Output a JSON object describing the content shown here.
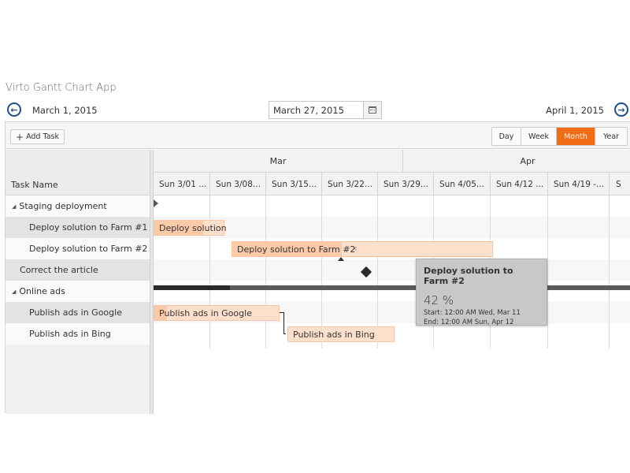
{
  "app": {
    "title": "Virto Gantt Chart App"
  },
  "nav": {
    "start_date": "March 1, 2015",
    "current_date": "March 27, 2015",
    "end_date": "April 1, 2015"
  },
  "toolbar": {
    "add_task_label": "Add Task",
    "views": [
      {
        "label": "Day",
        "active": false
      },
      {
        "label": "Week",
        "active": false
      },
      {
        "label": "Month",
        "active": true
      },
      {
        "label": "Year",
        "active": false
      }
    ]
  },
  "grid": {
    "column_header": "Task Name",
    "rows": [
      {
        "label": "Staging deployment",
        "expandable": true
      },
      {
        "label": "Deploy solution to Farm #1",
        "expandable": false
      },
      {
        "label": "Deploy solution to Farm #2",
        "expandable": false
      },
      {
        "label": "Correct the article",
        "expandable": false
      },
      {
        "label": "Online ads",
        "expandable": true
      },
      {
        "label": "Publish ads in Google",
        "expandable": false
      },
      {
        "label": "Publish ads in Bing",
        "expandable": false
      }
    ]
  },
  "timeline": {
    "months": [
      "Mar",
      "Apr"
    ],
    "weeks": [
      "Sun 3/01 ...",
      "Sun 3/08...",
      "Sun 3/15...",
      "Sun 3/22...",
      "Sun 3/29...",
      "Sun 4/05...",
      "Sun 4/12 ...",
      "Sun 4/19 -...",
      "S"
    ]
  },
  "bars": {
    "farm1": {
      "label": "Deploy solution",
      "progress": 0.7
    },
    "farm2": {
      "label": "Deploy solution to Farm #2",
      "progress": 0.42
    },
    "google": {
      "label": "Publish ads in Google",
      "progress": 0.1
    },
    "bing": {
      "label": "Publish ads in Bing",
      "progress": 0
    },
    "online_ads_summary_progress": 0.16
  },
  "tooltip": {
    "title": "Deploy solution to Farm #2",
    "percent": "42 %",
    "start": "Start: 12:00 AM Wed, Mar 11",
    "end": "End: 12:00 AM Sun, Apr 12"
  },
  "colors": {
    "accent": "#f26b15",
    "nav_icon": "#1f4f8a",
    "bar_fill": "#fde0cc",
    "summary": "#5b5b5b"
  },
  "icons": {
    "prev": "arrow-left-circle-icon",
    "next": "arrow-right-circle-icon",
    "calendar": "calendar-icon",
    "add": "plus-icon",
    "close": "close-icon"
  }
}
